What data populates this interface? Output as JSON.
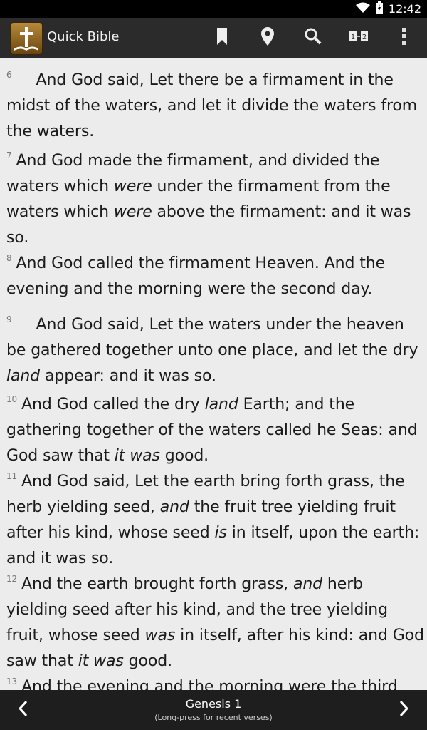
{
  "status": {
    "time": "12:42"
  },
  "app": {
    "title": "Quick Bible"
  },
  "toolbar": {
    "bookmark_icon": "bookmark-icon",
    "location_icon": "location-pin-icon",
    "search_icon": "search-icon",
    "compare_label": "1↔2",
    "overflow_icon": "overflow-menu-icon"
  },
  "verses": [
    {
      "num": "6",
      "segments": [
        {
          "t": "And God said, Let there be a firmament in the midst of the waters, and let it divide the waters from the waters."
        }
      ]
    },
    {
      "num": "7",
      "segments": [
        {
          "t": "And God made the firmament, and divided the waters which "
        },
        {
          "t": "were",
          "i": true
        },
        {
          "t": " under the firmament from the waters which "
        },
        {
          "t": "were",
          "i": true
        },
        {
          "t": " above the firmament: and it was so."
        }
      ]
    },
    {
      "num": "8",
      "segments": [
        {
          "t": "And God called the firmament Heaven. And the evening and the morning were the second day."
        }
      ]
    },
    {
      "num": "9",
      "segments": [
        {
          "t": "And God said, Let the waters under the heaven be gathered together unto one place, and let the dry "
        },
        {
          "t": "land",
          "i": true
        },
        {
          "t": " appear: and it was so."
        }
      ]
    },
    {
      "num": "10",
      "segments": [
        {
          "t": "And God called the dry "
        },
        {
          "t": "land",
          "i": true
        },
        {
          "t": " Earth; and the gathering together of the waters called he Seas: and God saw that "
        },
        {
          "t": "it was",
          "i": true
        },
        {
          "t": " good."
        }
      ]
    },
    {
      "num": "11",
      "segments": [
        {
          "t": "And God said, Let the earth bring forth grass, the herb yielding seed, "
        },
        {
          "t": "and",
          "i": true
        },
        {
          "t": " the fruit tree yielding fruit after his kind, whose seed "
        },
        {
          "t": "is",
          "i": true
        },
        {
          "t": " in itself, upon the earth: and it was so."
        }
      ]
    },
    {
      "num": "12",
      "segments": [
        {
          "t": "And the earth brought forth grass, "
        },
        {
          "t": "and",
          "i": true
        },
        {
          "t": " herb yielding seed after his kind, and the tree yielding fruit, whose seed "
        },
        {
          "t": "was",
          "i": true
        },
        {
          "t": " in itself, after his kind: and God saw that "
        },
        {
          "t": "it was",
          "i": true
        },
        {
          "t": " good."
        }
      ]
    },
    {
      "num": "13",
      "segments": [
        {
          "t": "And the evening and the morning were the third"
        }
      ]
    }
  ],
  "footer": {
    "reference": "Genesis 1",
    "hint": "(Long-press for recent verses)",
    "prev_icon": "chevron-left-icon",
    "next_icon": "chevron-right-icon"
  },
  "colors": {
    "status_bar": "#000000",
    "action_bar": "#2b2b2b",
    "content_bg": "#ececec",
    "bottom_bar": "#1e1e1e",
    "app_icon": "#9a6a22"
  }
}
